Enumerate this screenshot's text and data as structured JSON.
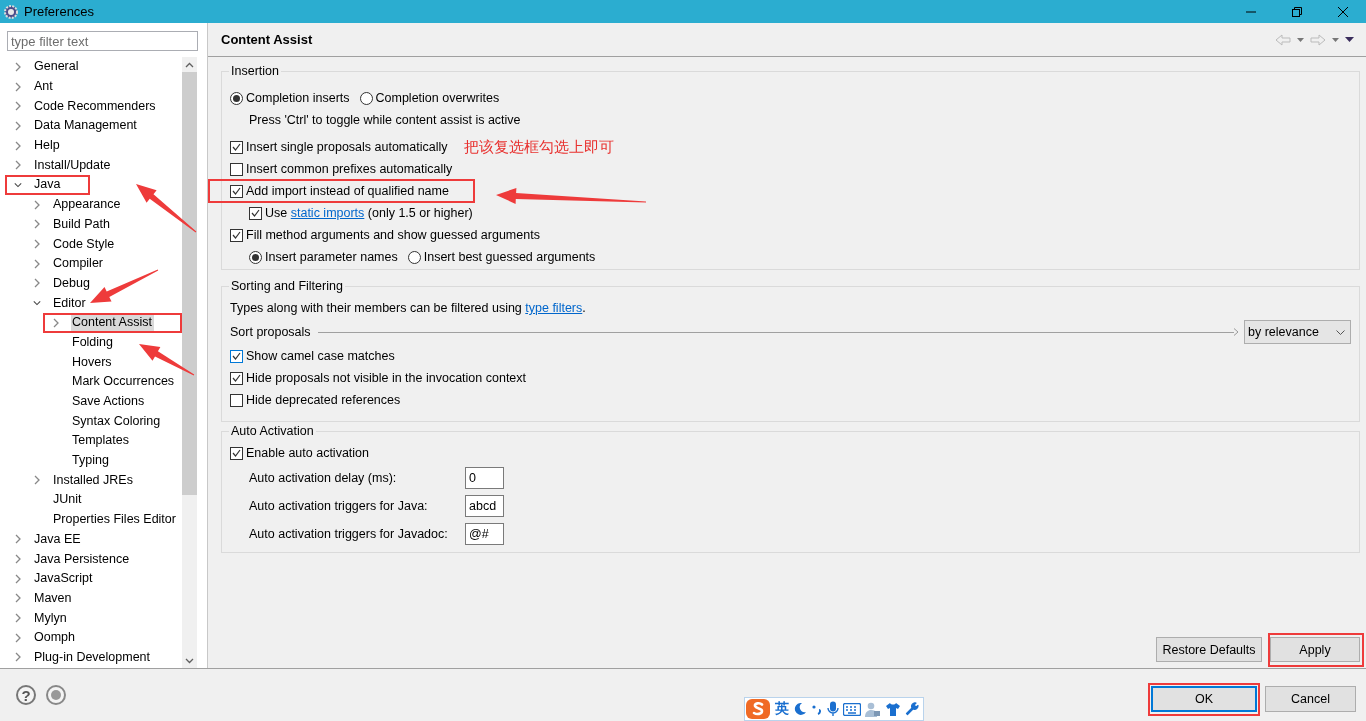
{
  "window": {
    "title": "Preferences"
  },
  "sidebar": {
    "filter_placeholder": "type filter text",
    "tree": [
      {
        "label": "General",
        "expanded": false,
        "selected": false,
        "highlighted": false
      },
      {
        "label": "Ant",
        "expanded": false,
        "selected": false,
        "highlighted": false
      },
      {
        "label": "Code Recommenders",
        "expanded": false,
        "selected": false,
        "highlighted": false
      },
      {
        "label": "Data Management",
        "expanded": false,
        "selected": false,
        "highlighted": false
      },
      {
        "label": "Help",
        "expanded": false,
        "selected": false,
        "highlighted": false
      },
      {
        "label": "Install/Update",
        "expanded": false,
        "selected": false,
        "highlighted": false
      },
      {
        "label": "Java",
        "expanded": true,
        "selected": false,
        "highlighted": true,
        "children": [
          {
            "label": "Appearance",
            "expanded": false,
            "selected": false,
            "highlighted": false
          },
          {
            "label": "Build Path",
            "expanded": false,
            "selected": false,
            "highlighted": false
          },
          {
            "label": "Code Style",
            "expanded": false,
            "selected": false,
            "highlighted": false
          },
          {
            "label": "Compiler",
            "expanded": false,
            "selected": false,
            "highlighted": false
          },
          {
            "label": "Debug",
            "expanded": false,
            "selected": false,
            "highlighted": false
          },
          {
            "label": "Editor",
            "expanded": true,
            "selected": false,
            "highlighted": false,
            "children": [
              {
                "label": "Content Assist",
                "expanded": false,
                "selected": true,
                "highlighted": true
              },
              {
                "label": "Folding",
                "selected": false,
                "highlighted": false
              },
              {
                "label": "Hovers",
                "selected": false,
                "highlighted": false
              },
              {
                "label": "Mark Occurrences",
                "selected": false,
                "highlighted": false
              },
              {
                "label": "Save Actions",
                "selected": false,
                "highlighted": false
              },
              {
                "label": "Syntax Coloring",
                "selected": false,
                "highlighted": false
              },
              {
                "label": "Templates",
                "selected": false,
                "highlighted": false
              },
              {
                "label": "Typing",
                "selected": false,
                "highlighted": false
              }
            ]
          },
          {
            "label": "Installed JREs",
            "expanded": false,
            "selected": false,
            "highlighted": false
          },
          {
            "label": "JUnit",
            "selected": false,
            "highlighted": false
          },
          {
            "label": "Properties Files Editor",
            "selected": false,
            "highlighted": false
          }
        ]
      },
      {
        "label": "Java EE",
        "expanded": false,
        "selected": false,
        "highlighted": false
      },
      {
        "label": "Java Persistence",
        "expanded": false,
        "selected": false,
        "highlighted": false
      },
      {
        "label": "JavaScript",
        "expanded": false,
        "selected": false,
        "highlighted": false
      },
      {
        "label": "Maven",
        "expanded": false,
        "selected": false,
        "highlighted": false
      },
      {
        "label": "Mylyn",
        "expanded": false,
        "selected": false,
        "highlighted": false
      },
      {
        "label": "Oomph",
        "expanded": false,
        "selected": false,
        "highlighted": false
      },
      {
        "label": "Plug-in Development",
        "expanded": false,
        "selected": false,
        "highlighted": false
      }
    ]
  },
  "page": {
    "title": "Content Assist",
    "groups": [
      {
        "title": "Insertion",
        "items": [
          {
            "kind": "radios",
            "options": [
              {
                "label": "Completion inserts",
                "selected": true
              },
              {
                "label": "Completion overwrites",
                "selected": false
              }
            ],
            "children": [
              {
                "kind": "note",
                "text": "Press 'Ctrl' to toggle while content assist is active"
              }
            ]
          },
          {
            "kind": "checkbox",
            "label": "Insert single proposals automatically",
            "checked": true,
            "highlighted": false,
            "annotation": "把该复选框勾选上即可"
          },
          {
            "kind": "checkbox",
            "label": "Insert common prefixes automatically",
            "checked": false,
            "highlighted": false
          },
          {
            "kind": "checkbox",
            "label": "Add import instead of qualified name",
            "checked": true,
            "highlighted": true,
            "children": [
              {
                "kind": "checkbox",
                "label": "Use",
                "link": "static imports",
                "suffix": "(only 1.5 or higher)",
                "checked": true,
                "highlighted": false
              }
            ]
          },
          {
            "kind": "checkbox",
            "label": "Fill method arguments and show guessed arguments",
            "checked": true,
            "highlighted": false,
            "children": [
              {
                "kind": "radios",
                "options": [
                  {
                    "label": "Insert parameter names",
                    "selected": true
                  },
                  {
                    "label": "Insert best guessed arguments",
                    "selected": false
                  }
                ]
              }
            ]
          }
        ]
      },
      {
        "title": "Sorting and Filtering",
        "items": [
          {
            "kind": "text",
            "text": "Types along with their members can be filtered using",
            "link": "type filters",
            "suffix": "."
          },
          {
            "kind": "select",
            "label": "Sort proposals",
            "value": "by relevance"
          },
          {
            "kind": "checkbox",
            "label": "Show camel case matches",
            "checked": true,
            "focused": true,
            "highlighted": false
          },
          {
            "kind": "checkbox",
            "label": "Hide proposals not visible in the invocation context",
            "checked": true,
            "highlighted": false
          },
          {
            "kind": "checkbox",
            "label": "Hide deprecated references",
            "checked": false,
            "highlighted": false
          }
        ]
      },
      {
        "title": "Auto Activation",
        "items": [
          {
            "kind": "checkbox",
            "label": "Enable auto activation",
            "checked": true,
            "highlighted": false,
            "children": [
              {
                "kind": "field",
                "label": "Auto activation delay (ms):",
                "value": "0"
              },
              {
                "kind": "field",
                "label": "Auto activation triggers for Java:",
                "value": "abcd"
              },
              {
                "kind": "field",
                "label": "Auto activation triggers for Javadoc:",
                "value": "@#"
              }
            ]
          }
        ]
      }
    ],
    "buttons": [
      {
        "label": "Restore Defaults",
        "highlighted": false
      },
      {
        "label": "Apply",
        "highlighted": true
      }
    ]
  },
  "footer": {
    "help_icon": "?",
    "ime_toolbar": {
      "mode_label": "英"
    },
    "buttons": [
      {
        "label": "OK",
        "focused": true,
        "highlighted": true
      },
      {
        "label": "Cancel",
        "focused": false,
        "highlighted": false
      }
    ]
  }
}
